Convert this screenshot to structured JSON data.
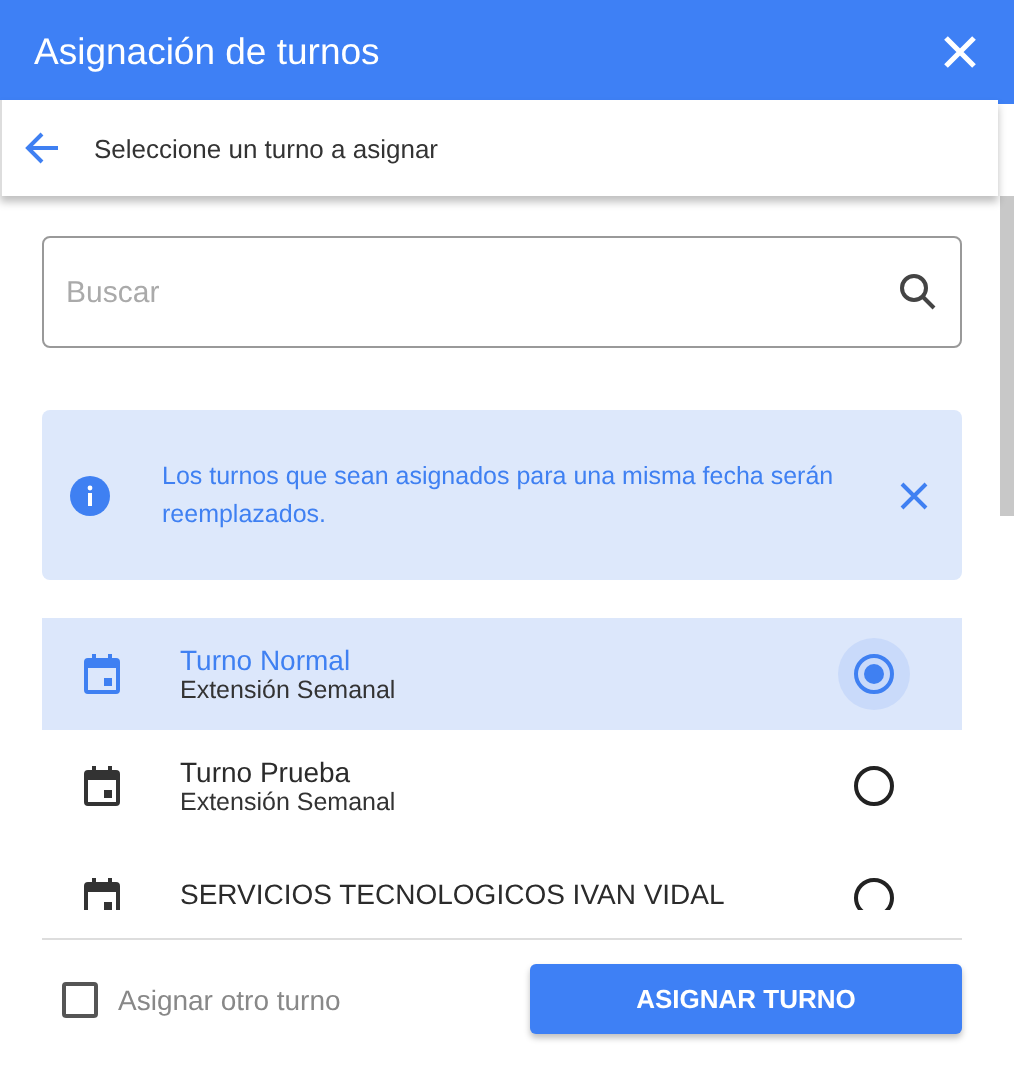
{
  "window": {
    "title": "Asignación de turnos"
  },
  "subheader": {
    "title": "Seleccione un turno a asignar"
  },
  "search": {
    "placeholder": "Buscar"
  },
  "alert": {
    "text": "Los turnos que sean asignados para una misma fecha serán reemplazados."
  },
  "shifts": [
    {
      "name": "Turno Normal",
      "subtitle": "Extensión Semanal",
      "selected": true
    },
    {
      "name": "Turno Prueba",
      "subtitle": "Extensión Semanal",
      "selected": false
    },
    {
      "name": "SERVICIOS TECNOLOGICOS IVAN VIDAL",
      "selected": false
    }
  ],
  "footer": {
    "checkbox": {
      "label": "Asignar otro turno",
      "checked": false
    },
    "button": "ASIGNAR TURNO"
  }
}
